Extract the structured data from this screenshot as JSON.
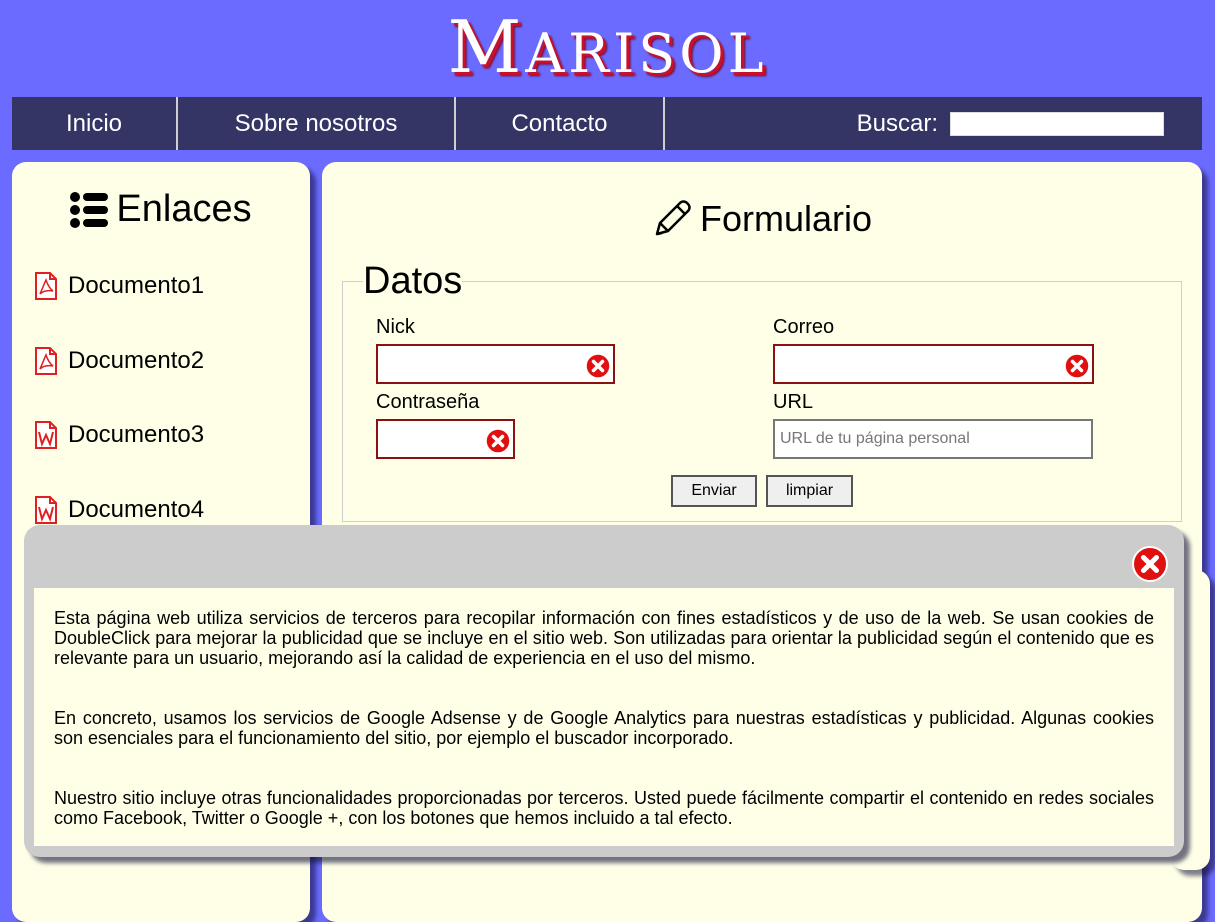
{
  "site": {
    "title_initial": "M",
    "title_rest": "ARISOL"
  },
  "nav": {
    "items": [
      "Inicio",
      "Sobre nosotros",
      "Contacto"
    ],
    "search_label": "Buscar:",
    "search_value": ""
  },
  "sidebar": {
    "title": "Enlaces",
    "links": [
      {
        "label": "Documento1",
        "icon": "pdf-icon"
      },
      {
        "label": "Documento2",
        "icon": "pdf-icon"
      },
      {
        "label": "Documento3",
        "icon": "word-icon"
      },
      {
        "label": "Documento4",
        "icon": "word-icon"
      }
    ]
  },
  "form": {
    "title": "Formulario",
    "legend": "Datos",
    "fields": {
      "nick": {
        "label": "Nick",
        "value": ""
      },
      "correo": {
        "label": "Correo",
        "value": ""
      },
      "contrasena": {
        "label": "Contraseña",
        "value": ""
      },
      "url": {
        "label": "URL",
        "value": "",
        "placeholder": "URL de tu página personal"
      }
    },
    "buttons": {
      "send": "Enviar",
      "clear": "limpiar"
    }
  },
  "cookie_notice": {
    "paragraphs": [
      "Esta página web utiliza servicios de terceros para recopilar información con fines estadísticos y de uso de la web. Se usan cookies de DoubleClick para mejorar la publicidad que se incluye en el sitio web. Son utilizadas para orientar la publicidad según el contenido que es relevante para un usuario, mejorando así la calidad de experiencia en el uso del mismo.",
      "En concreto, usamos los servicios de Google Adsense y de Google Analytics para nuestras estadísticas y publicidad. Algunas cookies son esenciales para el funcionamiento del sitio, por ejemplo el buscador incorporado.",
      "Nuestro sitio incluye otras funcionalidades proporcionadas por terceros. Usted puede fácilmente compartir el contenido en redes sociales como Facebook, Twitter o Google +, con los botones que hemos incluido a tal efecto."
    ]
  },
  "colors": {
    "background": "#6b6bff",
    "navbar": "#343465",
    "panel": "#ffffe8",
    "error_border": "#8b1010",
    "error_icon": "#e01010",
    "title_shadow": "#c8102e"
  }
}
